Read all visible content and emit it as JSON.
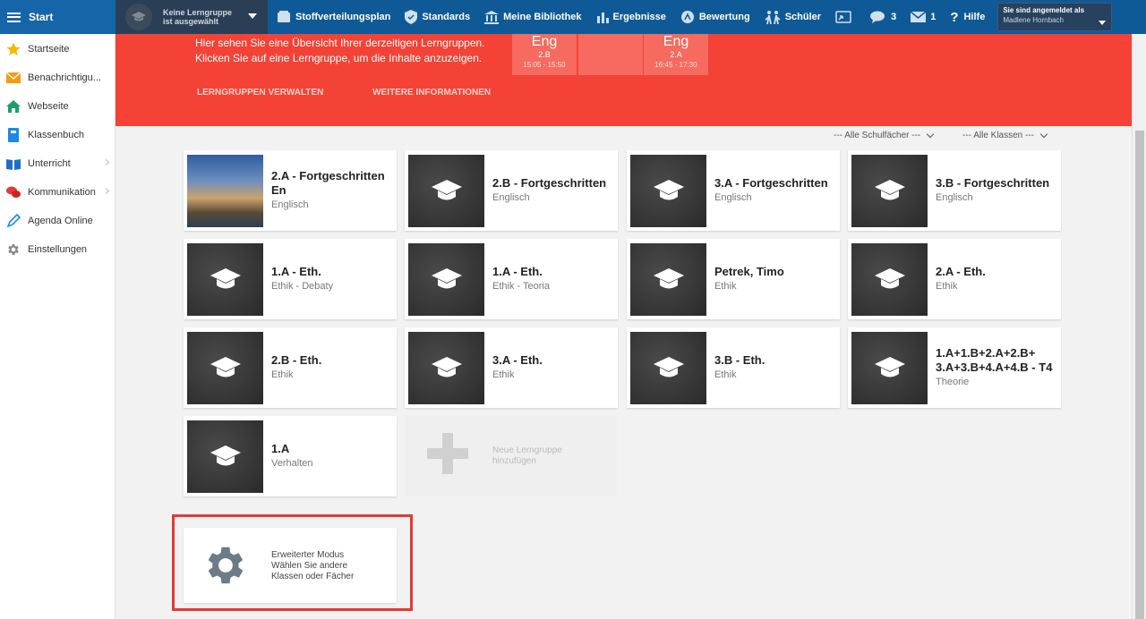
{
  "topbar": {
    "start_label": "Start",
    "group_line1": "Keine Lerngruppe",
    "group_line2": "ist ausgewählt",
    "nav": [
      {
        "label": "Stoffverteilungsplan",
        "icon": "book-icon"
      },
      {
        "label": "Standards",
        "icon": "shield-icon"
      },
      {
        "label": "Meine Bibliothek",
        "icon": "library-icon"
      },
      {
        "label": "Ergebnisse",
        "icon": "chart-icon"
      },
      {
        "label": "Bewertung",
        "icon": "grade-icon"
      },
      {
        "label": "Schüler",
        "icon": "students-icon"
      },
      {
        "label": "",
        "icon": "cast-icon"
      },
      {
        "label": "3",
        "icon": "chat-icon"
      },
      {
        "label": "1",
        "icon": "mail-icon"
      },
      {
        "label": "Hilfe",
        "icon": "help-icon"
      }
    ],
    "logged_in_label": "Sie sind angemeldet als",
    "user_name": "Madlene Hornbach"
  },
  "sidebar": {
    "items": [
      {
        "label": "Startseite",
        "icon": "star-icon",
        "color": "#f5b800"
      },
      {
        "label": "Benachrichtigu...",
        "icon": "envelope-icon",
        "color": "#f39c12"
      },
      {
        "label": "Webseite",
        "icon": "home-icon",
        "color": "#1e9e6a"
      },
      {
        "label": "Klassenbuch",
        "icon": "notebook-icon",
        "color": "#1e88e5"
      },
      {
        "label": "Unterricht",
        "icon": "open-book-icon",
        "color": "#1e6fc4"
      },
      {
        "label": "Kommunikation",
        "icon": "chat-bubbles-icon",
        "color": "#e53935"
      },
      {
        "label": "Agenda Online",
        "icon": "pen-icon",
        "color": "#1e88e5"
      },
      {
        "label": "Einstellungen",
        "icon": "gear-icon",
        "color": "#888888"
      }
    ]
  },
  "banner": {
    "line1": "Hier sehen Sie eine Übersicht Ihrer derzeitigen Lerngruppen.",
    "line2": "Klicken Sie auf eine Lerngruppe, um die Inhalte anzuzeigen.",
    "link_manage": "LERNGRUPPEN VERWALTEN",
    "link_more": "WEITERE INFORMATIONEN",
    "lessons": [
      {
        "subject": "Eng",
        "class": "2.B",
        "time": "15:05 - 15:50"
      },
      {
        "subject": "",
        "class": "",
        "time": ""
      },
      {
        "subject": "Eng",
        "class": "2.A",
        "time": "16:45 - 17:30"
      }
    ]
  },
  "filters": {
    "subjects": "--- Alle Schulfächer ---",
    "classes": "--- Alle Klassen ---"
  },
  "groups": [
    {
      "title": "2.A - Fortgeschritten En",
      "subtitle": "Englisch",
      "thumb": "photo"
    },
    {
      "title": "2.B - Fortgeschritten",
      "subtitle": "Englisch",
      "thumb": "cap"
    },
    {
      "title": "3.A - Fortgeschritten",
      "subtitle": "Englisch",
      "thumb": "cap"
    },
    {
      "title": "3.B - Fortgeschritten",
      "subtitle": "Englisch",
      "thumb": "cap"
    },
    {
      "title": "1.A - Eth.",
      "subtitle": "Ethik - Debaty",
      "thumb": "cap"
    },
    {
      "title": "1.A - Eth.",
      "subtitle": "Ethik - Teoria",
      "thumb": "cap"
    },
    {
      "title": "Petrek, Timo",
      "subtitle": "Ethik",
      "thumb": "cap"
    },
    {
      "title": "2.A - Eth.",
      "subtitle": "Ethik",
      "thumb": "cap"
    },
    {
      "title": "2.B - Eth.",
      "subtitle": "Ethik",
      "thumb": "cap"
    },
    {
      "title": "3.A - Eth.",
      "subtitle": "Ethik",
      "thumb": "cap"
    },
    {
      "title": "3.B - Eth.",
      "subtitle": "Ethik",
      "thumb": "cap"
    },
    {
      "title": "1.A+1.B+2.A+2.B+ 3.A+3.B+4.A+4.B - T4",
      "subtitle": "Theorie",
      "thumb": "cap"
    },
    {
      "title": "1.A",
      "subtitle": "Verhalten",
      "thumb": "cap"
    }
  ],
  "new_group": {
    "line1": "Neue Lerngruppe",
    "line2": "hinzufügen"
  },
  "advanced": {
    "line1": "Erweiterter Modus",
    "line2": "Wählen Sie andere",
    "line3": "Klassen oder Fächer"
  }
}
